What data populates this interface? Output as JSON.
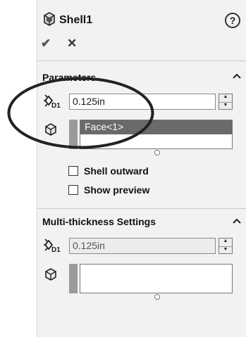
{
  "header": {
    "title": "Shell1",
    "help_icon": "?"
  },
  "actions": {
    "ok_glyph": "✔",
    "cancel_glyph": "✕"
  },
  "parameters": {
    "section_title": "Parameters",
    "thickness_value": "0.125in",
    "faces_selected": [
      "Face<1>"
    ],
    "shell_outward_label": "Shell outward",
    "show_preview_label": "Show preview"
  },
  "multi_thickness": {
    "section_title": "Multi-thickness Settings",
    "thickness_value": "0.125in"
  }
}
